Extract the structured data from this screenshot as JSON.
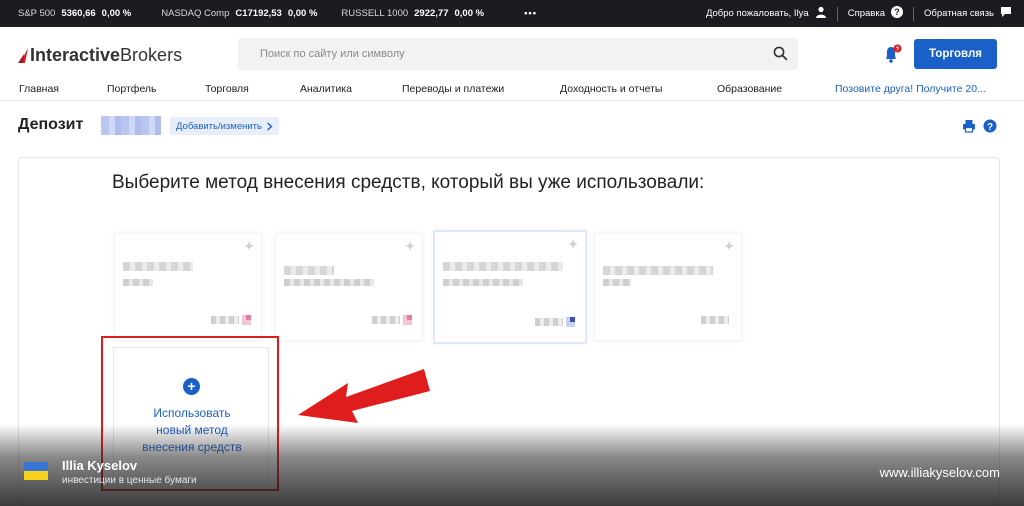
{
  "ticker": {
    "items": [
      {
        "name": "S&P 500",
        "value": "5360,66",
        "change": "0,00 %"
      },
      {
        "name": "NASDAQ Comp",
        "value": "C17192,53",
        "change": "0,00 %"
      },
      {
        "name": "RUSSELL 1000",
        "value": "2922,77",
        "change": "0,00 %"
      }
    ],
    "more": "•••",
    "welcome": "Добро пожаловать, Ilya",
    "help": "Справка",
    "feedback": "Обратная связь"
  },
  "header": {
    "logo_brand": "Interactive",
    "logo_brand2": "Brokers",
    "search_placeholder": "Поиск по сайту или символу",
    "notifications_count": "",
    "trade_button": "Торговля"
  },
  "nav": {
    "items": [
      "Главная",
      "Портфель",
      "Торговля",
      "Аналитика",
      "Переводы и платежи",
      "Доходность и отчеты",
      "Образование"
    ],
    "promo": "Позовите друга! Получите 20..."
  },
  "page": {
    "title": "Депозит",
    "edit_button": "Добавить/изменить",
    "heading": "Выберите метод внесения средств, который вы уже использовали:",
    "new_method_label": "Использовать\nновый метод\nвнесения средств"
  },
  "icons": {
    "search": "search-icon",
    "bell": "bell-icon",
    "user": "user-icon",
    "help": "help-icon",
    "chat": "chat-icon",
    "print": "print-icon",
    "star": "star-icon",
    "plus": "plus-icon",
    "arrow": "red-arrow-icon"
  },
  "colors": {
    "brand_blue": "#1960c9",
    "ticker_bg": "#1b1b22",
    "highlight_red": "#e01d1d",
    "logo_red": "#d81f26"
  },
  "footer": {
    "author": "Illia Kyselov",
    "author_subtitle": "инвестиции в ценные бумаги",
    "site": "www.illiakyselov.com"
  }
}
